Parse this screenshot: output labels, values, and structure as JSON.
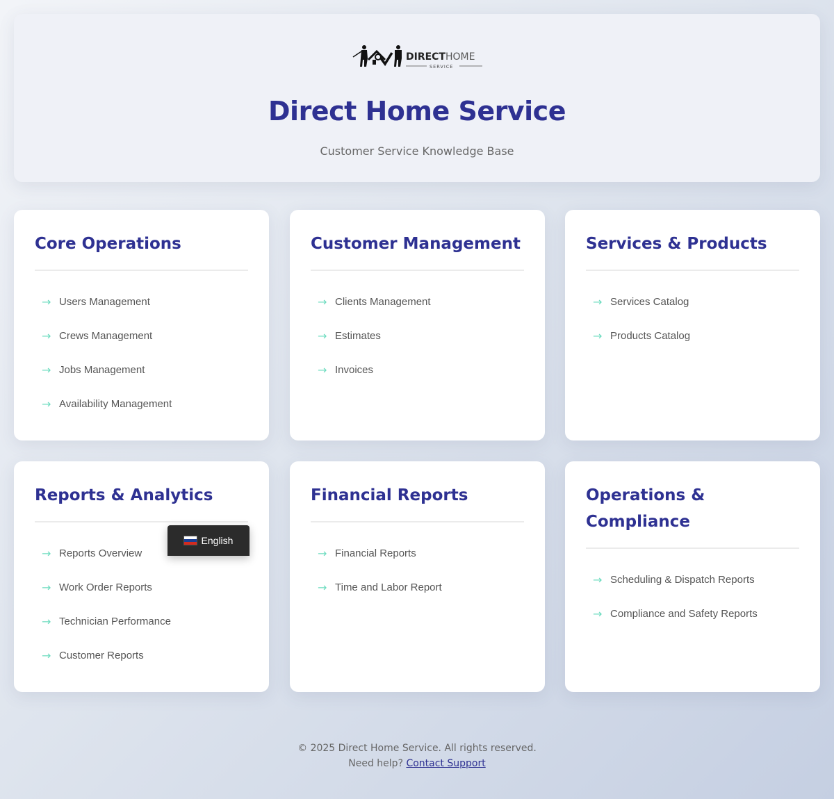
{
  "header": {
    "logo_text_bold": "DIRECT",
    "logo_text_light": "HOME",
    "logo_subtext": "SERVICE",
    "title": "Direct Home Service",
    "subtitle": "Customer Service Knowledge Base"
  },
  "arrow_glyph": "→",
  "accent_color": "#2e3192",
  "arrow_color": "#6fdcc0",
  "sections": [
    {
      "title": "Core Operations",
      "links": [
        "Users Management",
        "Crews Management",
        "Jobs Management",
        "Availability Management"
      ]
    },
    {
      "title": "Customer Management",
      "links": [
        "Clients Management",
        "Estimates",
        "Invoices"
      ]
    },
    {
      "title": "Services & Products",
      "links": [
        "Services Catalog",
        "Products Catalog"
      ]
    },
    {
      "title": "Reports & Analytics",
      "links": [
        "Reports Overview",
        "Work Order Reports",
        "Technician Performance",
        "Customer Reports"
      ]
    },
    {
      "title": "Financial Reports",
      "links": [
        "Financial Reports",
        "Time and Labor Report"
      ]
    },
    {
      "title": "Operations & Compliance",
      "links": [
        "Scheduling & Dispatch Reports",
        "Compliance and Safety Reports"
      ]
    }
  ],
  "language": {
    "label": "English",
    "flag_icon": "flag-icon"
  },
  "footer": {
    "copyright": "© 2025 Direct Home Service. All rights reserved.",
    "help_text": "Need help?",
    "support_link": "Contact Support"
  }
}
